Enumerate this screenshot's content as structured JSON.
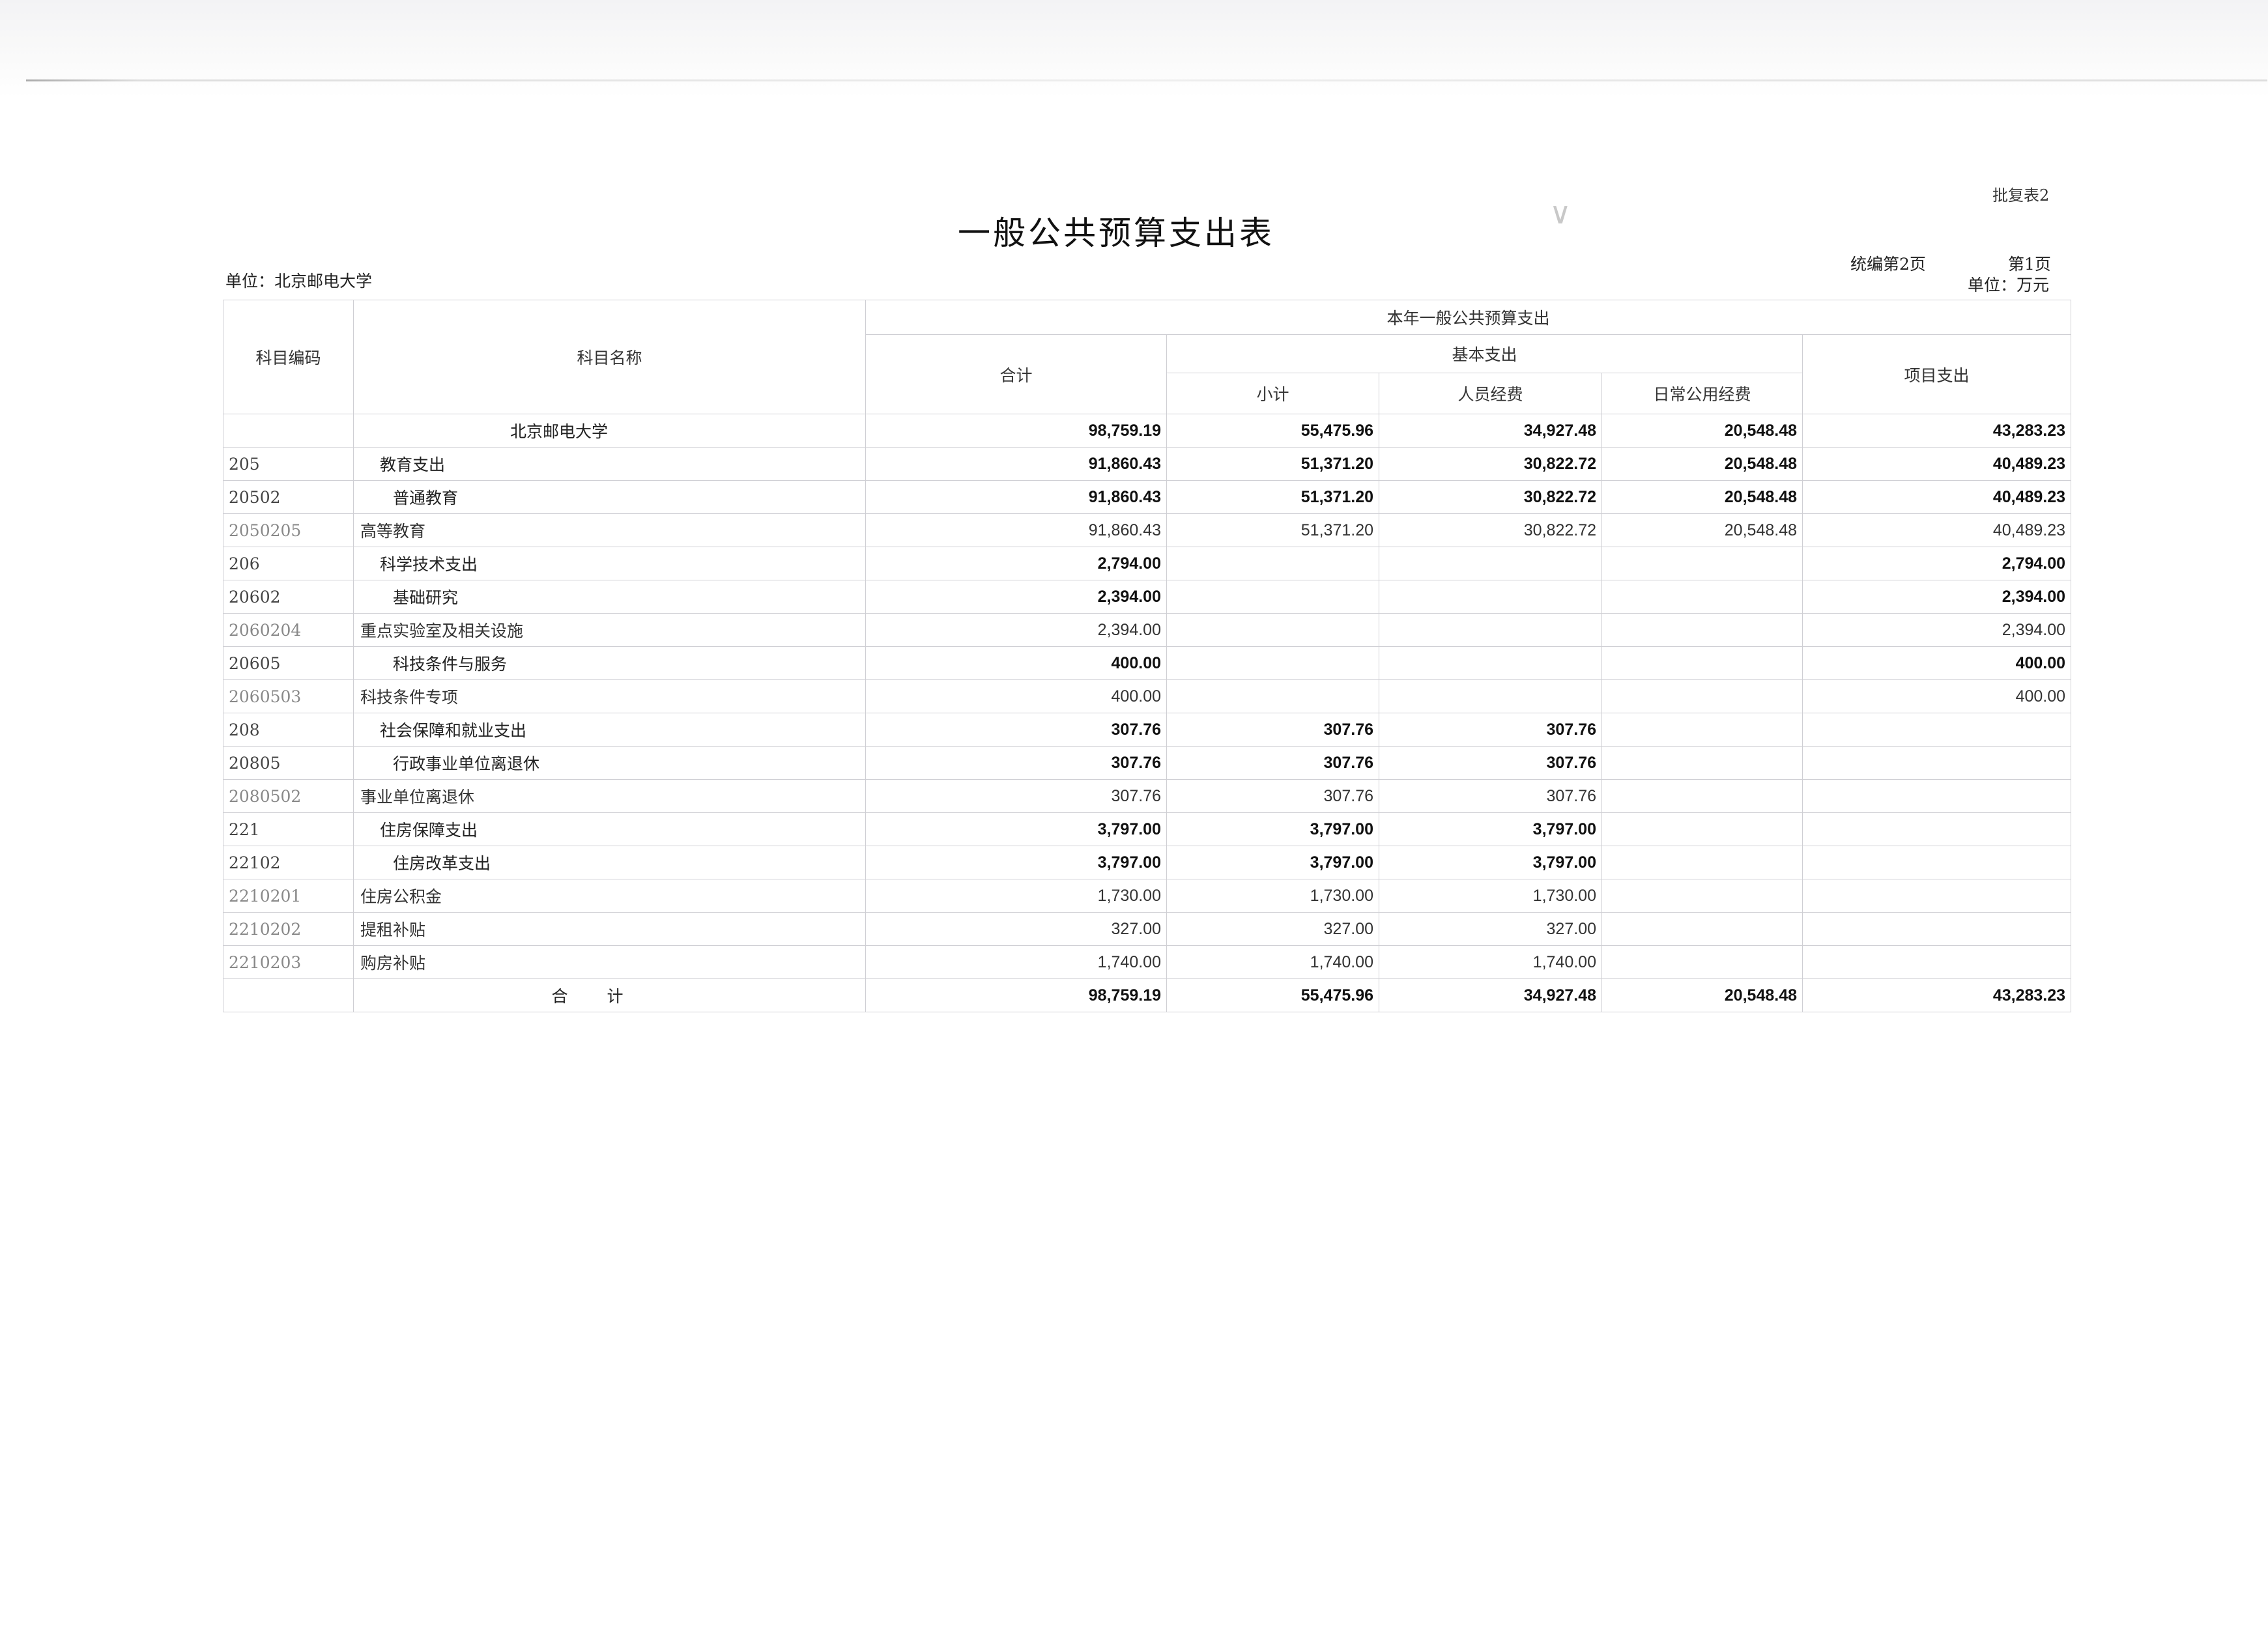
{
  "document": {
    "title": "一般公共预算支出表",
    "form_tag": "批复表2",
    "unit_org": "单位：北京邮电大学",
    "page_compiled": "统编第2页",
    "page_no": "第1页",
    "unit_currency": "单位：万元"
  },
  "table": {
    "headers": {
      "code": "科目编码",
      "name": "科目名称",
      "group": "本年一般公共预算支出",
      "total": "合计",
      "basic": "基本支出",
      "subtotal": "小计",
      "personnel": "人员经费",
      "public": "日常公用经费",
      "project": "项目支出"
    },
    "rows": [
      {
        "code": "",
        "name": "北京邮电大学",
        "level": 0,
        "bold": true,
        "total": "98,759.19",
        "subtotal": "55,475.96",
        "personnel": "34,927.48",
        "public": "20,548.48",
        "project": "43,283.23"
      },
      {
        "code": "205",
        "name": "教育支出",
        "level": 1,
        "bold": true,
        "total": "91,860.43",
        "subtotal": "51,371.20",
        "personnel": "30,822.72",
        "public": "20,548.48",
        "project": "40,489.23"
      },
      {
        "code": "20502",
        "name": "普通教育",
        "level": 2,
        "bold": true,
        "total": "91,860.43",
        "subtotal": "51,371.20",
        "personnel": "30,822.72",
        "public": "20,548.48",
        "project": "40,489.23"
      },
      {
        "code": "2050205",
        "name": "高等教育",
        "level": 3,
        "bold": false,
        "total": "91,860.43",
        "subtotal": "51,371.20",
        "personnel": "30,822.72",
        "public": "20,548.48",
        "project": "40,489.23"
      },
      {
        "code": "206",
        "name": "科学技术支出",
        "level": 1,
        "bold": true,
        "total": "2,794.00",
        "subtotal": "",
        "personnel": "",
        "public": "",
        "project": "2,794.00"
      },
      {
        "code": "20602",
        "name": "基础研究",
        "level": 2,
        "bold": true,
        "total": "2,394.00",
        "subtotal": "",
        "personnel": "",
        "public": "",
        "project": "2,394.00"
      },
      {
        "code": "2060204",
        "name": "重点实验室及相关设施",
        "level": 3,
        "bold": false,
        "total": "2,394.00",
        "subtotal": "",
        "personnel": "",
        "public": "",
        "project": "2,394.00"
      },
      {
        "code": "20605",
        "name": "科技条件与服务",
        "level": 2,
        "bold": true,
        "total": "400.00",
        "subtotal": "",
        "personnel": "",
        "public": "",
        "project": "400.00"
      },
      {
        "code": "2060503",
        "name": "科技条件专项",
        "level": 3,
        "bold": false,
        "total": "400.00",
        "subtotal": "",
        "personnel": "",
        "public": "",
        "project": "400.00"
      },
      {
        "code": "208",
        "name": "社会保障和就业支出",
        "level": 1,
        "bold": true,
        "total": "307.76",
        "subtotal": "307.76",
        "personnel": "307.76",
        "public": "",
        "project": ""
      },
      {
        "code": "20805",
        "name": "行政事业单位离退休",
        "level": 2,
        "bold": true,
        "total": "307.76",
        "subtotal": "307.76",
        "personnel": "307.76",
        "public": "",
        "project": ""
      },
      {
        "code": "2080502",
        "name": "事业单位离退休",
        "level": 3,
        "bold": false,
        "total": "307.76",
        "subtotal": "307.76",
        "personnel": "307.76",
        "public": "",
        "project": ""
      },
      {
        "code": "221",
        "name": "住房保障支出",
        "level": 1,
        "bold": true,
        "total": "3,797.00",
        "subtotal": "3,797.00",
        "personnel": "3,797.00",
        "public": "",
        "project": ""
      },
      {
        "code": "22102",
        "name": "住房改革支出",
        "level": 2,
        "bold": true,
        "total": "3,797.00",
        "subtotal": "3,797.00",
        "personnel": "3,797.00",
        "public": "",
        "project": ""
      },
      {
        "code": "2210201",
        "name": "住房公积金",
        "level": 3,
        "bold": false,
        "total": "1,730.00",
        "subtotal": "1,730.00",
        "personnel": "1,730.00",
        "public": "",
        "project": ""
      },
      {
        "code": "2210202",
        "name": "提租补贴",
        "level": 3,
        "bold": false,
        "total": "327.00",
        "subtotal": "327.00",
        "personnel": "327.00",
        "public": "",
        "project": ""
      },
      {
        "code": "2210203",
        "name": "购房补贴",
        "level": 3,
        "bold": false,
        "total": "1,740.00",
        "subtotal": "1,740.00",
        "personnel": "1,740.00",
        "public": "",
        "project": ""
      }
    ],
    "total_row": {
      "label": "合计",
      "total": "98,759.19",
      "subtotal": "55,475.96",
      "personnel": "34,927.48",
      "public": "20,548.48",
      "project": "43,283.23"
    }
  }
}
